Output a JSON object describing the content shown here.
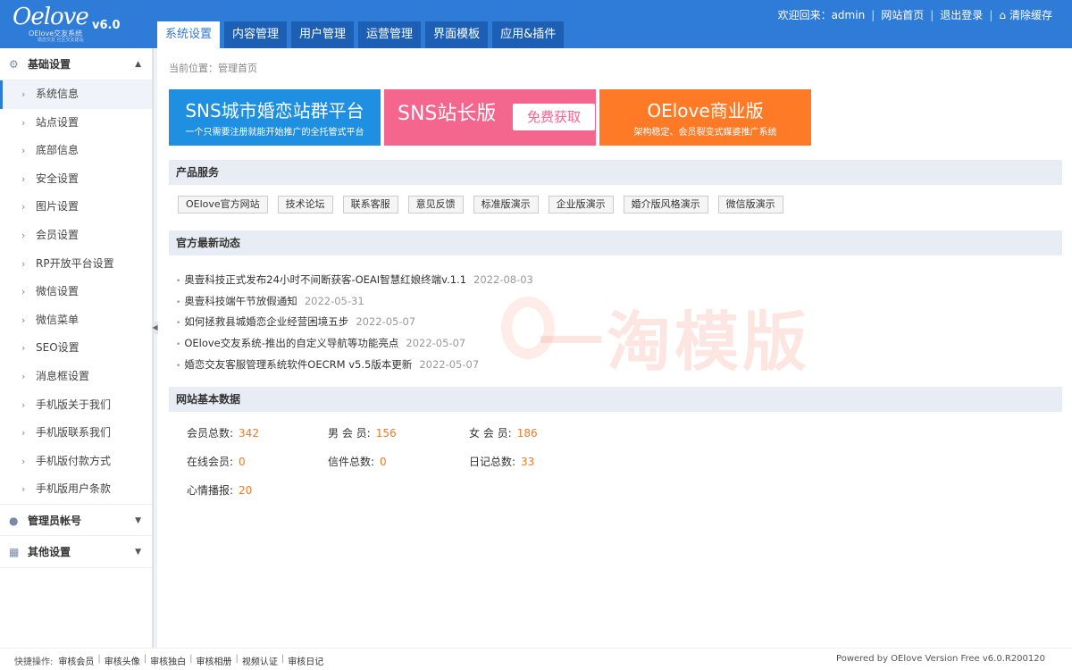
{
  "header": {
    "logo_script": "Oelove",
    "logo_sub": "OElove交友系统",
    "logo_sub2": "婚恋交友 社区交友建站",
    "version": "v6.0",
    "tabs": [
      {
        "label": "系统设置",
        "active": true
      },
      {
        "label": "内容管理",
        "active": false
      },
      {
        "label": "用户管理",
        "active": false
      },
      {
        "label": "运营管理",
        "active": false
      },
      {
        "label": "界面模板",
        "active": false
      },
      {
        "label": "应用&插件",
        "active": false
      }
    ],
    "welcome": "欢迎回来：admin",
    "home_link": "网站首页",
    "logout_link": "退出登录",
    "clear_cache": "清除缓存"
  },
  "sidebar": {
    "group1": "基础设置",
    "items": [
      "系统信息",
      "站点设置",
      "底部信息",
      "安全设置",
      "图片设置",
      "会员设置",
      "RP开放平台设置",
      "微信设置",
      "微信菜单",
      "SEO设置",
      "消息框设置",
      "手机版关于我们",
      "手机版联系我们",
      "手机版付款方式",
      "手机版用户条款"
    ],
    "group2": "管理员帐号",
    "group3": "其他设置"
  },
  "main": {
    "breadcrumb": "当前位置：管理首页",
    "banner1_title": "SNS城市婚恋站群平台",
    "banner1_sub": "一个只需要注册就能开始推广的全托管式平台",
    "banner2_title": "SNS站长版",
    "banner2_pill": "免费获取",
    "banner3_title": "OElove商业版",
    "banner3_sub": "架构稳定、会员裂变式媒婆推广系统",
    "services_title": "产品服务",
    "services": [
      "OElove官方网站",
      "技术论坛",
      "联系客服",
      "意见反馈",
      "标准版演示",
      "企业版演示",
      "婚介版风格演示",
      "微信版演示"
    ],
    "news_title": "官方最新动态",
    "news": [
      {
        "title": "奥壹科技正式发布24小时不间断获客-OEAI智慧红娘终端v.1.1",
        "date": "2022-08-03"
      },
      {
        "title": "奥壹科技端午节放假通知",
        "date": "2022-05-31"
      },
      {
        "title": "如何拯救县城婚恋企业经营困境五步",
        "date": "2022-05-07"
      },
      {
        "title": "OElove交友系统-推出的自定义导航等功能亮点",
        "date": "2022-05-07"
      },
      {
        "title": "婚恋交友客服管理系统软件OECRM v5.5版本更新",
        "date": "2022-05-07"
      }
    ],
    "watermark": "一淘模版",
    "stats_title": "网站基本数据",
    "stats": [
      {
        "label": "会员总数:",
        "value": "342"
      },
      {
        "label": "男 会 员:",
        "value": "156"
      },
      {
        "label": "女 会 员:",
        "value": "186"
      },
      {
        "label": "在线会员:",
        "value": "0"
      },
      {
        "label": "信件总数:",
        "value": "0"
      },
      {
        "label": "日记总数:",
        "value": "33"
      },
      {
        "label": "心情播报:",
        "value": "20"
      }
    ]
  },
  "footer": {
    "quick_label": "快捷操作:",
    "quick_links": [
      "审核会员",
      "审核头像",
      "审核独白",
      "审核相册",
      "视频认证",
      "审核日记"
    ],
    "powered": "Powered by OElove Version Free v6.0.R200120"
  },
  "colors": {
    "header_bg": "#2f7bd8",
    "tab_bg": "#1d5fb5",
    "accent": "#f07a2a",
    "banner1": "#1e8fe1",
    "banner2": "#f4668e",
    "banner3": "#ff7a26"
  }
}
